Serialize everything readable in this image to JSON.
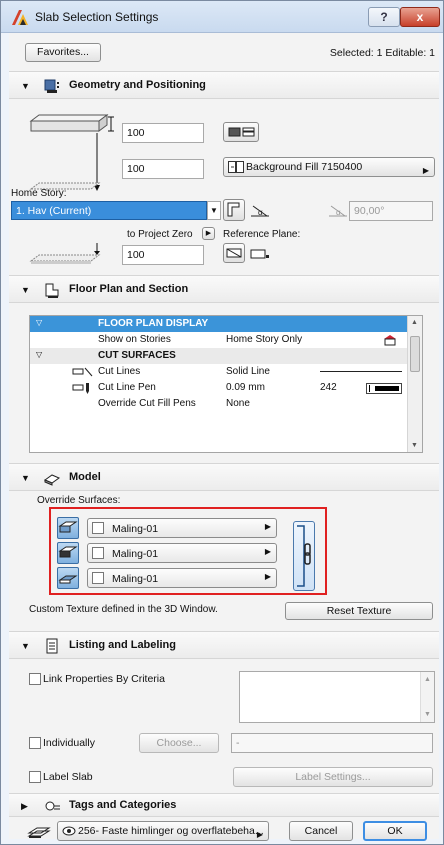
{
  "window": {
    "title": "Slab Selection Settings",
    "help_label": "?",
    "close_label": "x"
  },
  "top": {
    "favorites_label": "Favorites...",
    "selected_info": "Selected: 1 Editable: 1"
  },
  "geometry": {
    "title": "Geometry and Positioning",
    "thickness_value": "100",
    "offset_value": "100",
    "home_story_label": "Home Story:",
    "home_story_value": "1. Hav (Current)",
    "fill_label": "Background Fill 7150400",
    "angle_value": "90,00°",
    "to_project_zero_label": "to Project Zero",
    "project_zero_value": "100",
    "reference_plane_label": "Reference Plane:"
  },
  "floor_plan": {
    "title": "Floor Plan and Section",
    "rows": [
      {
        "name": "FLOOR PLAN DISPLAY",
        "value": "",
        "extra": "",
        "type": "header"
      },
      {
        "name": "Show on Stories",
        "value": "Home Story Only",
        "extra": "",
        "type": "item"
      },
      {
        "name": "CUT SURFACES",
        "value": "",
        "extra": "",
        "type": "group"
      },
      {
        "name": "Cut Lines",
        "value": "Solid Line",
        "extra": "",
        "type": "item"
      },
      {
        "name": "Cut Line Pen",
        "value": "0.09 mm",
        "extra": "242",
        "type": "item"
      },
      {
        "name": "Override Cut Fill Pens",
        "value": "None",
        "extra": "",
        "type": "item"
      }
    ]
  },
  "model": {
    "title": "Model",
    "override_label": "Override Surfaces:",
    "surfaces": [
      "Maling-01",
      "Maling-01",
      "Maling-01"
    ],
    "custom_texture_note": "Custom Texture defined in the 3D Window.",
    "reset_texture_label": "Reset Texture"
  },
  "listing": {
    "title": "Listing and Labeling",
    "link_properties_label": "Link Properties By Criteria",
    "individually_label": "Individually",
    "choose_label": "Choose...",
    "choose_field_value": "-",
    "label_slab_label": "Label Slab",
    "label_settings_label": "Label Settings..."
  },
  "tags": {
    "title": "Tags and Categories"
  },
  "footer": {
    "layer_label": "256- Faste himlinger og overflatebeha...",
    "cancel_label": "Cancel",
    "ok_label": "OK"
  }
}
